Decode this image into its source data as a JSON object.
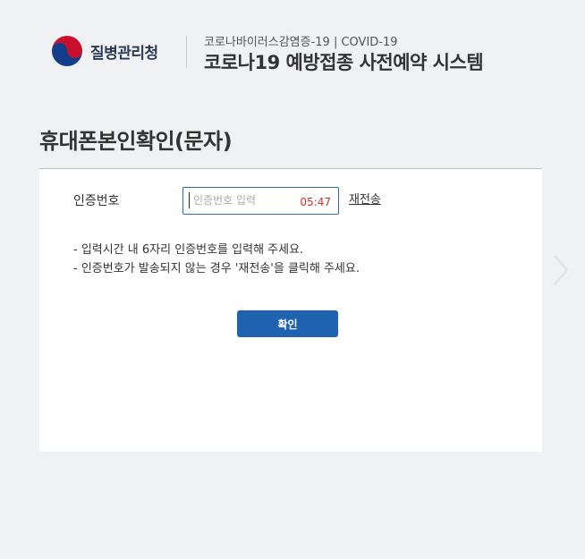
{
  "header": {
    "logo_text": "질병관리청",
    "subtitle": "코로나바이러스감염증-19 | COVID-19",
    "title": "코로나19 예방접종 사전예약 시스템"
  },
  "page": {
    "title": "휴대폰본인확인(문자)"
  },
  "form": {
    "code_label": "인증번호",
    "code_placeholder": "인증번호 입력",
    "code_value": "",
    "timer": "05:47",
    "resend_label": "재전송",
    "notes": [
      "- 입력시간 내 6자리 인증번호를 입력해 주세요.",
      "- 인증번호가 발송되지 않는 경우 '재전송'을 클릭해 주세요."
    ],
    "confirm_label": "확인"
  },
  "colors": {
    "accent": "#1f63b0",
    "timer": "#d0312d",
    "background": "#f0f1f3"
  },
  "icons": {
    "logo": "taegeuk-emblem-icon",
    "next": "chevron-right-icon"
  }
}
